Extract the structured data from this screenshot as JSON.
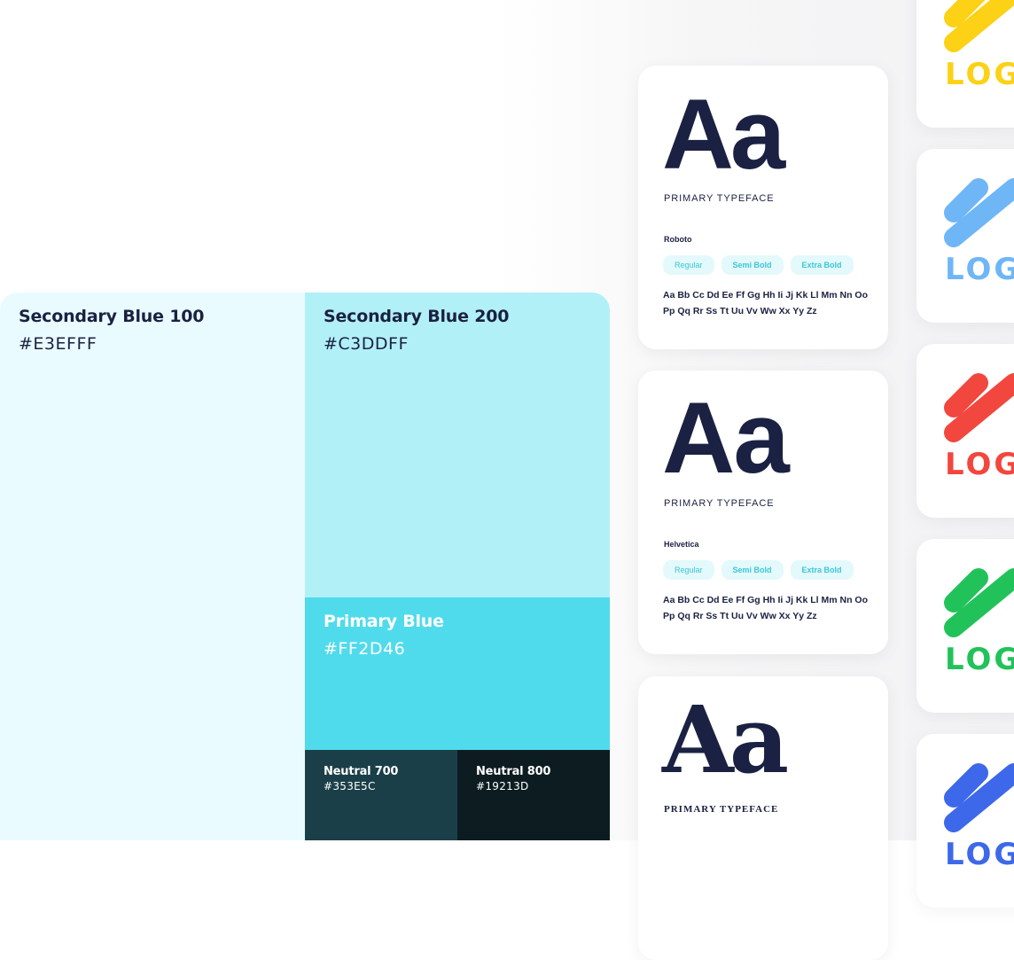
{
  "palette": {
    "secondary_100": {
      "name": "Secondary Blue 100",
      "hex": "#E3EFFF",
      "bg": "#e9fbfe",
      "text_color": "#1b2142"
    },
    "secondary_200": {
      "name": "Secondary Blue 200",
      "hex": "#C3DDFF",
      "bg": "#b2f0f8",
      "text_color": "#1b2142"
    },
    "primary": {
      "name": "Primary Blue",
      "hex": "#FF2D46",
      "bg": "#50dbec",
      "text_color": "#ffffff"
    },
    "neutral_700": {
      "name": "Neutral 700",
      "hex": "#353E5C",
      "bg": "#1b3f48"
    },
    "neutral_800": {
      "name": "Neutral 800",
      "hex": "#19213D",
      "bg": "#0d1c20"
    }
  },
  "typefaces": [
    {
      "sample": "Aa",
      "label": "PRIMARY TYPEFACE",
      "font_name": "Roboto",
      "weights": [
        "Regular",
        "Semi Bold",
        "Extra Bold"
      ],
      "alphabet": "Aa Bb Cc Dd Ee Ff Gg Hh Ii Jj Kk Ll Mm Nn Oo Pp Qq Rr Ss Tt Uu Vv Ww Xx Yy Zz"
    },
    {
      "sample": "Aa",
      "label": "PRIMARY TYPEFACE",
      "font_name": "Helvetica",
      "weights": [
        "Regular",
        "Semi Bold",
        "Extra Bold"
      ],
      "alphabet": "Aa Bb Cc Dd Ee Ff Gg Hh Ii Jj Kk Ll Mm Nn Oo Pp Qq Rr Ss Tt Uu Vv Ww Xx Yy Zz"
    },
    {
      "sample": "Aa",
      "label": "PRIMARY TYPEFACE"
    }
  ],
  "logos": [
    {
      "text": "LOG",
      "color": "#fcd116",
      "icon": "logo-mark-icon"
    },
    {
      "text": "LOG",
      "color": "#6fb6f7",
      "icon": "logo-mark-icon"
    },
    {
      "text": "LOG",
      "color": "#f2473e",
      "icon": "logo-mark-icon"
    },
    {
      "text": "LOG",
      "color": "#22c25a",
      "icon": "logo-mark-icon"
    },
    {
      "text": "LOG",
      "color": "#3d68e9",
      "icon": "logo-mark-icon"
    }
  ]
}
